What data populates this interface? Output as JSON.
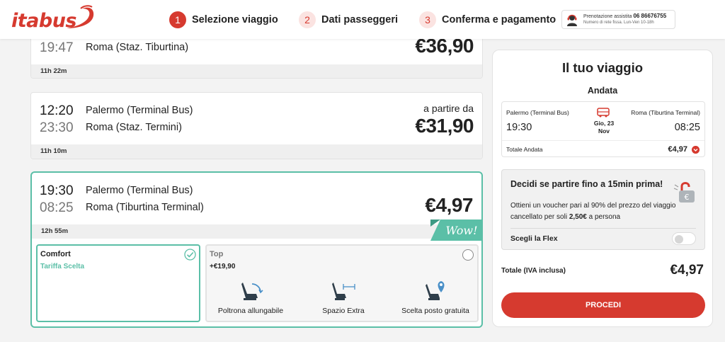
{
  "header": {
    "logo_text": "itabus",
    "steps": [
      {
        "num": "1",
        "label": "Selezione viaggio"
      },
      {
        "num": "2",
        "label": "Dati passeggeri"
      },
      {
        "num": "3",
        "label": "Conferma e pagamento"
      }
    ],
    "assist": {
      "label": "Prenotazione assistita",
      "phone": "06 86676755",
      "note": "Numero di rete fissa. Lun-Ven 10-18h"
    }
  },
  "trips": [
    {
      "arrival_time": "19:47",
      "arrival_station": "Roma (Staz. Tiburtina)",
      "price": "€36,90",
      "duration": "11h 22m"
    },
    {
      "departure_time": "12:20",
      "departure_station": "Palermo (Terminal Bus)",
      "arrival_time": "23:30",
      "arrival_station": "Roma (Staz. Termini)",
      "from_label": "a partire da",
      "price": "€31,90",
      "duration": "11h 10m"
    },
    {
      "departure_time": "19:30",
      "departure_station": "Palermo (Terminal Bus)",
      "arrival_time": "08:25",
      "arrival_station": "Roma (Tiburtina Terminal)",
      "price": "€4,97",
      "duration": "12h 55m",
      "badge": "Wow!"
    }
  ],
  "fares": {
    "comfort": {
      "name": "Comfort",
      "tag": "Tariffa Scelta",
      "selected": true
    },
    "top": {
      "name": "Top",
      "price": "+€19,90",
      "selected": false,
      "features": [
        {
          "icon": "reclining-seat-icon",
          "label": "Poltrona allungabile"
        },
        {
          "icon": "extra-space-seat-icon",
          "label": "Spazio Extra"
        },
        {
          "icon": "seat-location-icon",
          "label": "Scelta posto gratuita"
        }
      ]
    }
  },
  "sidebar": {
    "title": "Il tuo viaggio",
    "subtitle": "Andata",
    "from_station": "Palermo (Terminal Bus)",
    "to_station": "Roma (Tiburtina Terminal)",
    "departure_time": "19:30",
    "arrival_time": "08:25",
    "date_line1": "Gio, 23",
    "date_line2": "Nov",
    "total_andata_label": "Totale Andata",
    "total_andata_value": "€4,97",
    "flex": {
      "title": "Decidi se partire fino a 15min prima!",
      "desc_before": "Ottieni un voucher pari al 90% del prezzo del viaggio cancellato per soli ",
      "desc_amount": "2,50€",
      "desc_after": " a persona",
      "choose_label": "Scegli la Flex",
      "toggle_on": false
    },
    "total_label": "Totale (IVA inclusa)",
    "total_value": "€4,97",
    "proceed_label": "PROCEDI"
  },
  "colors": {
    "brand_red": "#d63a2f",
    "accent_teal": "#5bbfa7"
  }
}
